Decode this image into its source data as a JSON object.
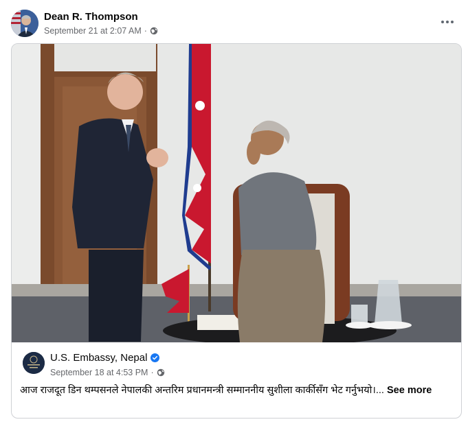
{
  "post": {
    "author": "Dean R. Thompson",
    "timestamp": "September 21 at 2:07 AM",
    "separator": "·",
    "privacy_icon": "globe-icon",
    "menu_icon": "more-options-icon"
  },
  "shared": {
    "page_name": "U.S. Embassy, Nepal",
    "verified_icon": "verified-badge-icon",
    "timestamp": "September 18 at 4:53 PM",
    "separator": "·",
    "privacy_icon": "globe-icon",
    "text": "आज राजदूत डिन थम्पसनले नेपालकी अन्तरिम प्रधानमन्त्री सम्माननीय सुशीला कार्कीसँग भेट गर्नुभयो।...",
    "see_more": "See more",
    "avatar_text": "U.S. EMBASSY Nepal"
  },
  "colors": {
    "secondary_text": "#65676b",
    "verified_blue": "#1877f2",
    "card_border": "#ced0d4"
  }
}
